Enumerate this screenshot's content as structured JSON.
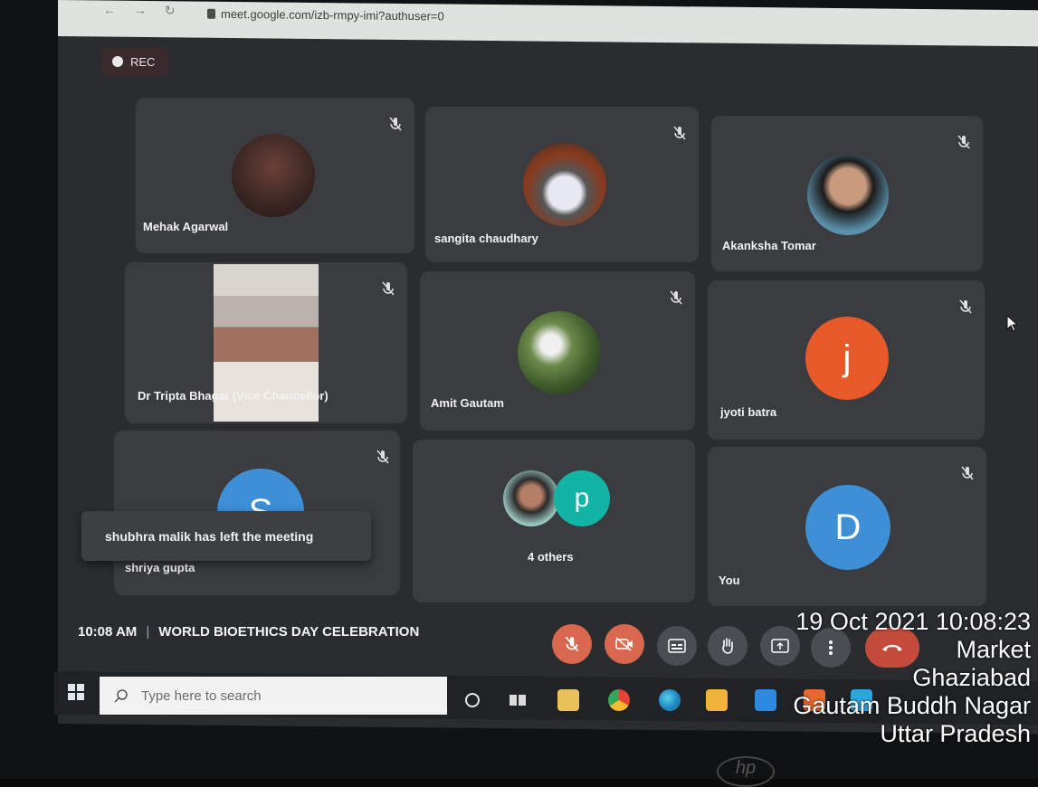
{
  "browser": {
    "url": "meet.google.com/izb-rmpy-imi?authuser=0",
    "nav": "← → ↻"
  },
  "rec_label": "REC",
  "participants": [
    {
      "name": "Mehak Agarwal",
      "avatar": "photo",
      "muted": true
    },
    {
      "name": "sangita chaudhary",
      "avatar": "photo",
      "muted": true
    },
    {
      "name": "Akanksha Tomar",
      "avatar": "photo",
      "muted": true
    },
    {
      "name": "Dr Tripta Bhagat (Vice Chancellor)",
      "avatar": "video",
      "muted": true
    },
    {
      "name": "Amit Gautam",
      "avatar": "photo",
      "muted": true
    },
    {
      "name": "jyoti batra",
      "avatar": "letter",
      "letter": "j",
      "color": "#e8592a",
      "muted": true
    },
    {
      "name": "shriya gupta",
      "avatar": "letter",
      "letter": "S",
      "color": "#3d8fd6",
      "muted": true
    },
    {
      "name": "4 others",
      "avatar": "group",
      "letter": "p",
      "color": "#12b5a5",
      "muted": false
    },
    {
      "name": "You",
      "avatar": "letter",
      "letter": "D",
      "color": "#3d8fd6",
      "muted": true
    }
  ],
  "toast": "shubhra malik has left the meeting",
  "meeting": {
    "time": "10:08 AM",
    "separator": "|",
    "title": "WORLD BIOETHICS DAY CELEBRATION"
  },
  "taskbar": {
    "search_placeholder": "Type here to search"
  },
  "stamp": {
    "datetime": "19 Oct 2021 10:08:23",
    "line1": "Market",
    "line2": "Ghaziabad",
    "line3": "Gautam Buddh Nagar",
    "line4": "Uttar Pradesh"
  },
  "brand": "hp",
  "icons": [
    "mic-off-icon",
    "camera-off-icon",
    "captions-icon",
    "raise-hand-icon",
    "present-icon",
    "more-icon",
    "hang-up-icon",
    "windows-icon",
    "search-icon",
    "cortana-icon",
    "task-view-icon"
  ],
  "colors": {
    "accent_red": "#d8694f",
    "hangup": "#c24b3c",
    "tile": "#3a3c40"
  }
}
